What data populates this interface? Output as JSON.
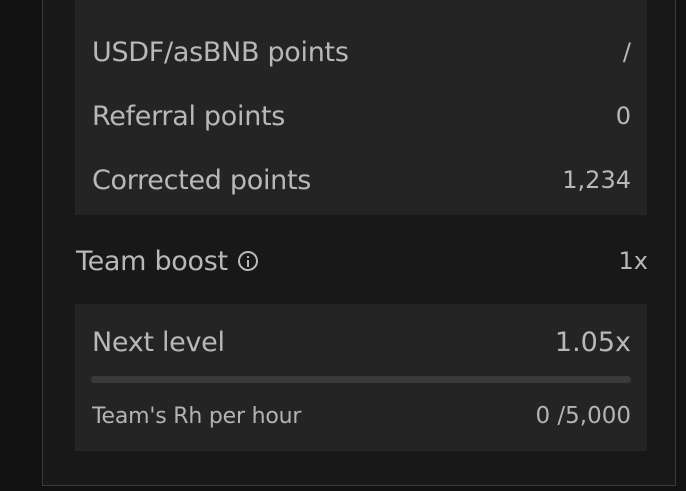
{
  "points": {
    "rows": [
      {
        "label": "USDF/asBNB points",
        "value": "/"
      },
      {
        "label": "Referral points",
        "value": "0"
      },
      {
        "label": "Corrected points",
        "value": "1,234"
      }
    ]
  },
  "team_boost": {
    "label": "Team boost",
    "value": "1x"
  },
  "next_level": {
    "label": "Next level",
    "value": "1.05x",
    "progress_fraction": 0,
    "rh_label": "Team's Rh per hour",
    "rh_value": "0 /5,000"
  }
}
